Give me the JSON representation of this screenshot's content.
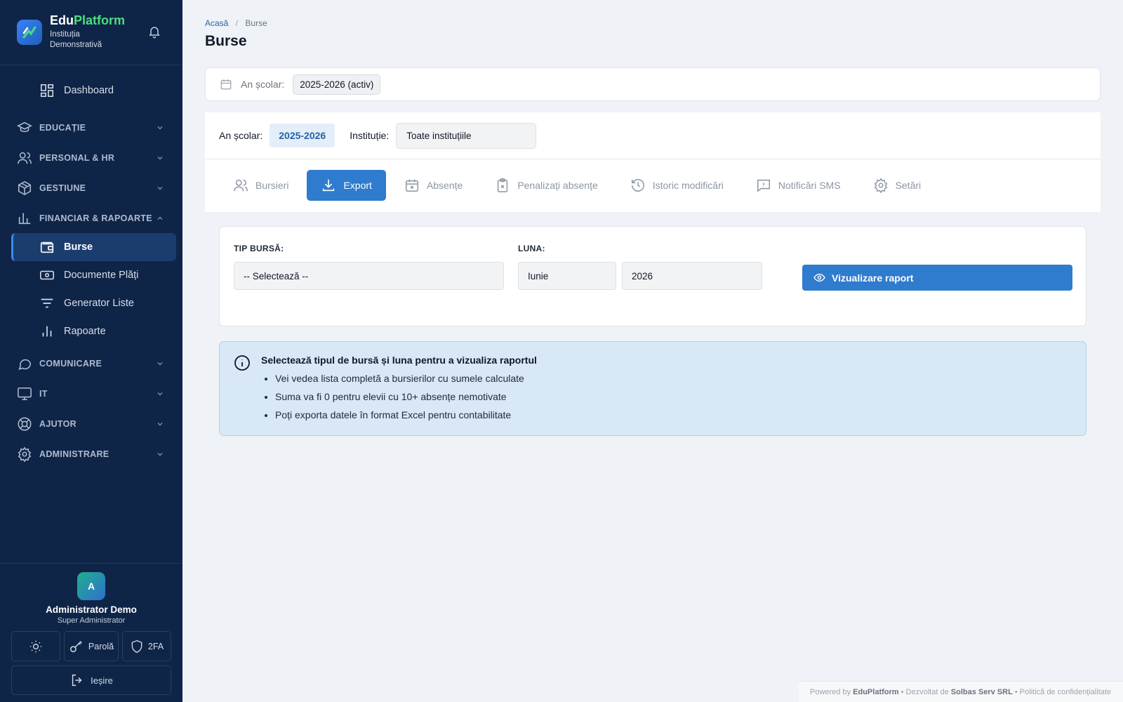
{
  "brand": {
    "name_part1": "Edu",
    "name_part2": "Platform",
    "institution": "Instituția Demonstrativă"
  },
  "nav": {
    "dashboard": "Dashboard",
    "sections": {
      "educatie": "EDUCAȚIE",
      "personal": "PERSONAL & HR",
      "gestiune": "GESTIUNE",
      "financiar": "FINANCIAR & RAPOARTE",
      "comunicare": "COMUNICARE",
      "it": "IT",
      "ajutor": "AJUTOR",
      "administrare": "ADMINISTRARE"
    },
    "financiar_items": {
      "burse": "Burse",
      "documente": "Documente Plăți",
      "generator": "Generator Liste",
      "rapoarte": "Rapoarte"
    }
  },
  "user": {
    "initial": "A",
    "name": "Administrator Demo",
    "role": "Super Administrator",
    "password_label": "Parolă",
    "twofa_label": "2FA",
    "logout_label": "Ieșire"
  },
  "breadcrumb": {
    "home": "Acasă",
    "separator": "/",
    "current": "Burse"
  },
  "page_title": "Burse",
  "school_year_bar": {
    "label": "An școlar:",
    "value": "2025-2026 (activ)"
  },
  "filters": {
    "year_label": "An școlar:",
    "year_value": "2025-2026",
    "institution_label": "Instituție:",
    "institution_value": "Toate instituțiile"
  },
  "tabs": {
    "bursieri": "Bursieri",
    "export": "Export",
    "absente": "Absențe",
    "penalizati": "Penalizați absențe",
    "istoric": "Istoric modificări",
    "sms": "Notificări SMS",
    "setari": "Setări"
  },
  "export_form": {
    "tip_label": "TIP BURSĂ:",
    "tip_value": "-- Selectează --",
    "luna_label": "LUNA:",
    "month_value": "Iunie",
    "year_value": "2026",
    "view_button": "Vizualizare raport"
  },
  "info": {
    "title": "Selectează tipul de bursă și luna pentru a vizualiza raportul",
    "items": [
      "Vei vedea lista completă a bursierilor cu sumele calculate",
      "Suma va fi 0 pentru elevii cu 10+ absențe nemotivate",
      "Poți exporta datele în format Excel pentru contabilitate"
    ]
  },
  "footer": {
    "powered_prefix": "Powered by",
    "powered_brand": "EduPlatform",
    "sep1": "•",
    "dev_prefix": "Dezvoltat de",
    "dev_company": "Solbas Serv SRL",
    "sep2": "•",
    "privacy": "Politică de confidențialitate"
  },
  "colors": {
    "sidebar": "#0f2547",
    "accent": "#2f7bce",
    "brand_green": "#4ade80",
    "info_bg": "#d9e8f6"
  },
  "icons": [
    "bell-icon",
    "dashboard-icon",
    "graduation-cap-icon",
    "users-icon",
    "box-icon",
    "bar-chart-icon",
    "wallet-icon",
    "payment-icon",
    "filter-icon",
    "message-icon",
    "monitor-icon",
    "lifebuoy-icon",
    "gear-icon",
    "sun-icon",
    "key-icon",
    "shield-icon",
    "logout-icon",
    "calendar-icon",
    "download-icon",
    "clipboard-x-icon",
    "history-icon",
    "sms-icon",
    "eye-icon",
    "info-icon",
    "chevron-down-icon",
    "chevron-up-icon"
  ]
}
